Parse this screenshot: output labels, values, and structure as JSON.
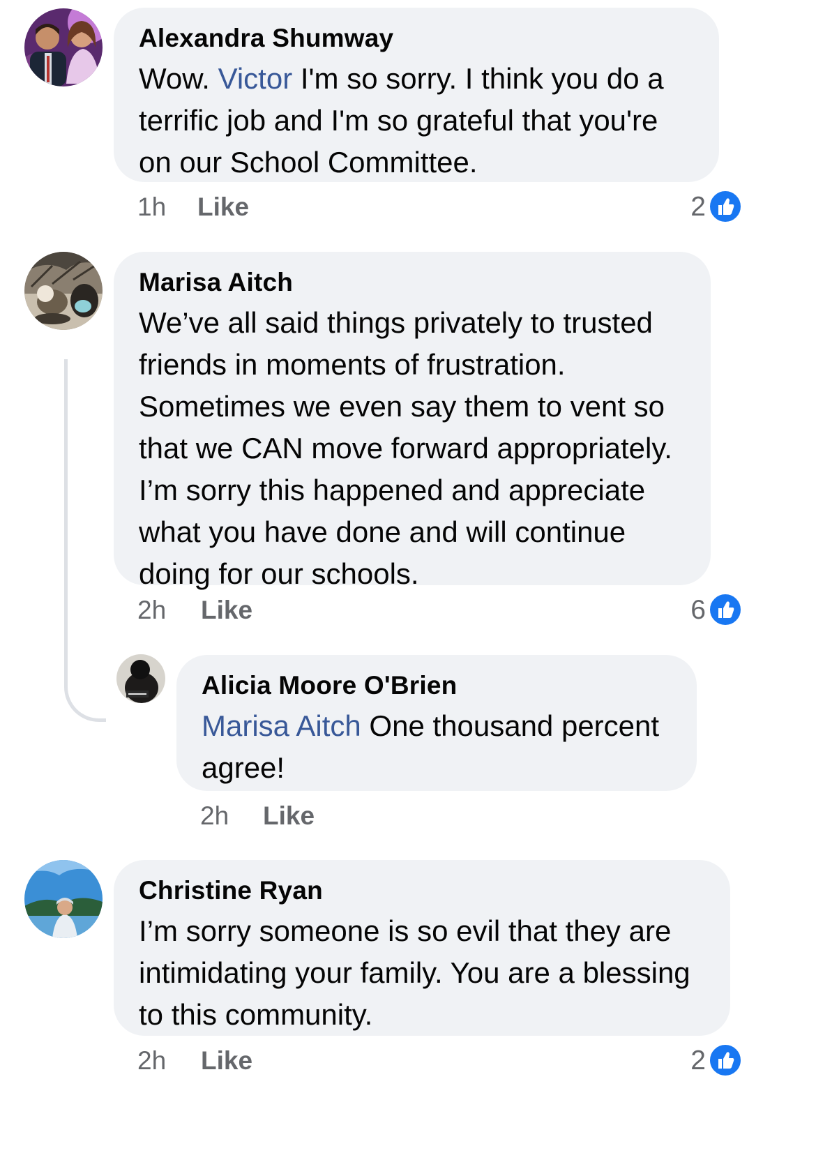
{
  "comments": [
    {
      "author": "Alexandra Shumway",
      "text_before": "Wow.  ",
      "mention": "Victor",
      "text": " I'm so sorry.  I think you do a terrific job and I'm so grateful that you're on our School Committee.",
      "time": "1h",
      "like_label": "Like",
      "reaction_count": "2"
    },
    {
      "author": "Marisa Aitch",
      "text": "We’ve all said things privately to trusted friends in moments of frustration. Sometimes we even say them to vent so that we CAN move forward appropriately. I’m sorry this happened and appreciate what you have done and will continue doing for our schools.",
      "time": "2h",
      "like_label": "Like",
      "reaction_count": "6"
    },
    {
      "author": "Alicia Moore O'Brien",
      "mention": "Marisa Aitch",
      "text": " One thousand percent agree!",
      "time": "2h",
      "like_label": "Like"
    },
    {
      "author": "Christine Ryan",
      "text": "I’m sorry someone is so evil that they are intimidating your family. You are a blessing to this community.",
      "time": "2h",
      "like_label": "Like",
      "reaction_count": "2"
    }
  ],
  "colors": {
    "bubble": "#f0f2f5",
    "mention": "#385898",
    "meta": "#65676b",
    "like_reaction": "#1877f2"
  },
  "icons": {
    "reaction": "thumbs-up-icon"
  }
}
